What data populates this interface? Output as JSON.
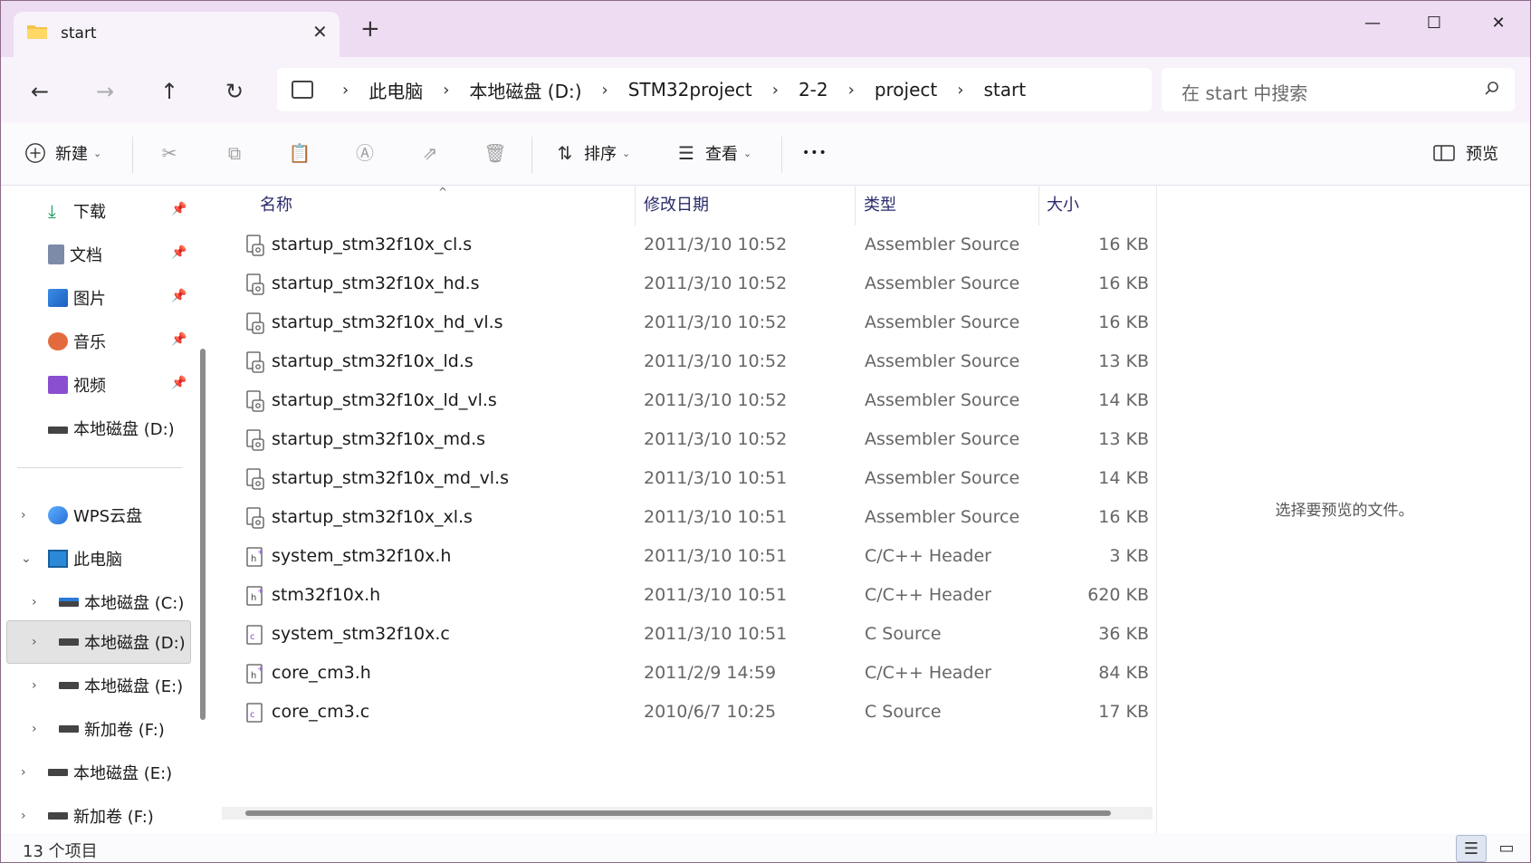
{
  "tab": {
    "title": "start",
    "close_glyph": "✕",
    "new_tab_glyph": "+"
  },
  "window_controls": {
    "minimize": "—",
    "maximize": "☐",
    "close": "✕"
  },
  "nav": {
    "back": "←",
    "forward": "→",
    "up": "↑",
    "refresh": "↻"
  },
  "breadcrumb": [
    "此电脑",
    "本地磁盘 (D:)",
    "STM32project",
    "2-2",
    "project",
    "start"
  ],
  "search": {
    "placeholder": "在 start 中搜索"
  },
  "toolbar": {
    "new_label": "新建",
    "sort_label": "排序",
    "view_label": "查看",
    "more_label": "•••",
    "preview_label": "预览"
  },
  "sidebar": {
    "quick_access": [
      {
        "label": "下载",
        "icon": "download-icon"
      },
      {
        "label": "文档",
        "icon": "document-icon"
      },
      {
        "label": "图片",
        "icon": "pictures-icon"
      },
      {
        "label": "音乐",
        "icon": "music-icon"
      },
      {
        "label": "视频",
        "icon": "video-icon"
      },
      {
        "label": "本地磁盘 (D:)",
        "icon": "drive-icon"
      }
    ],
    "tree": [
      {
        "label": "WPS云盘",
        "icon": "cloud-icon",
        "expanded": false
      },
      {
        "label": "此电脑",
        "icon": "computer-icon",
        "expanded": true
      },
      {
        "label": "本地磁盘 (C:)",
        "icon": "drive-c-icon",
        "expanded": false
      },
      {
        "label": "本地磁盘 (D:)",
        "icon": "drive-icon",
        "expanded": false,
        "selected": true
      },
      {
        "label": "本地磁盘 (E:)",
        "icon": "drive-icon",
        "expanded": false
      },
      {
        "label": "新加卷 (F:)",
        "icon": "drive-icon",
        "expanded": false
      },
      {
        "label": "本地磁盘 (E:)",
        "icon": "drive-icon",
        "expanded": false
      },
      {
        "label": "新加卷 (F:)",
        "icon": "drive-icon",
        "expanded": false
      }
    ]
  },
  "columns": {
    "name": "名称",
    "date": "修改日期",
    "type": "类型",
    "size": "大小"
  },
  "files": [
    {
      "name": "startup_stm32f10x_cl.s",
      "date": "2011/3/10 10:52",
      "type": "Assembler Source",
      "size": "16 KB",
      "kind": "asm"
    },
    {
      "name": "startup_stm32f10x_hd.s",
      "date": "2011/3/10 10:52",
      "type": "Assembler Source",
      "size": "16 KB",
      "kind": "asm"
    },
    {
      "name": "startup_stm32f10x_hd_vl.s",
      "date": "2011/3/10 10:52",
      "type": "Assembler Source",
      "size": "16 KB",
      "kind": "asm"
    },
    {
      "name": "startup_stm32f10x_ld.s",
      "date": "2011/3/10 10:52",
      "type": "Assembler Source",
      "size": "13 KB",
      "kind": "asm"
    },
    {
      "name": "startup_stm32f10x_ld_vl.s",
      "date": "2011/3/10 10:52",
      "type": "Assembler Source",
      "size": "14 KB",
      "kind": "asm"
    },
    {
      "name": "startup_stm32f10x_md.s",
      "date": "2011/3/10 10:52",
      "type": "Assembler Source",
      "size": "13 KB",
      "kind": "asm"
    },
    {
      "name": "startup_stm32f10x_md_vl.s",
      "date": "2011/3/10 10:51",
      "type": "Assembler Source",
      "size": "14 KB",
      "kind": "asm"
    },
    {
      "name": "startup_stm32f10x_xl.s",
      "date": "2011/3/10 10:51",
      "type": "Assembler Source",
      "size": "16 KB",
      "kind": "asm"
    },
    {
      "name": "system_stm32f10x.h",
      "date": "2011/3/10 10:51",
      "type": "C/C++ Header",
      "size": "3 KB",
      "kind": "h"
    },
    {
      "name": "stm32f10x.h",
      "date": "2011/3/10 10:51",
      "type": "C/C++ Header",
      "size": "620 KB",
      "kind": "h"
    },
    {
      "name": "system_stm32f10x.c",
      "date": "2011/3/10 10:51",
      "type": "C Source",
      "size": "36 KB",
      "kind": "c"
    },
    {
      "name": "core_cm3.h",
      "date": "2011/2/9 14:59",
      "type": "C/C++ Header",
      "size": "84 KB",
      "kind": "h"
    },
    {
      "name": "core_cm3.c",
      "date": "2010/6/7 10:25",
      "type": "C Source",
      "size": "17 KB",
      "kind": "c"
    }
  ],
  "preview": {
    "message": "选择要预览的文件。"
  },
  "status": {
    "count": "13 个项目"
  },
  "colors": {
    "titlebar": "#eddcf2",
    "navrow": "#f8f3fa",
    "accent": "#0067c0",
    "selected_bg": "#e3e3e3"
  }
}
